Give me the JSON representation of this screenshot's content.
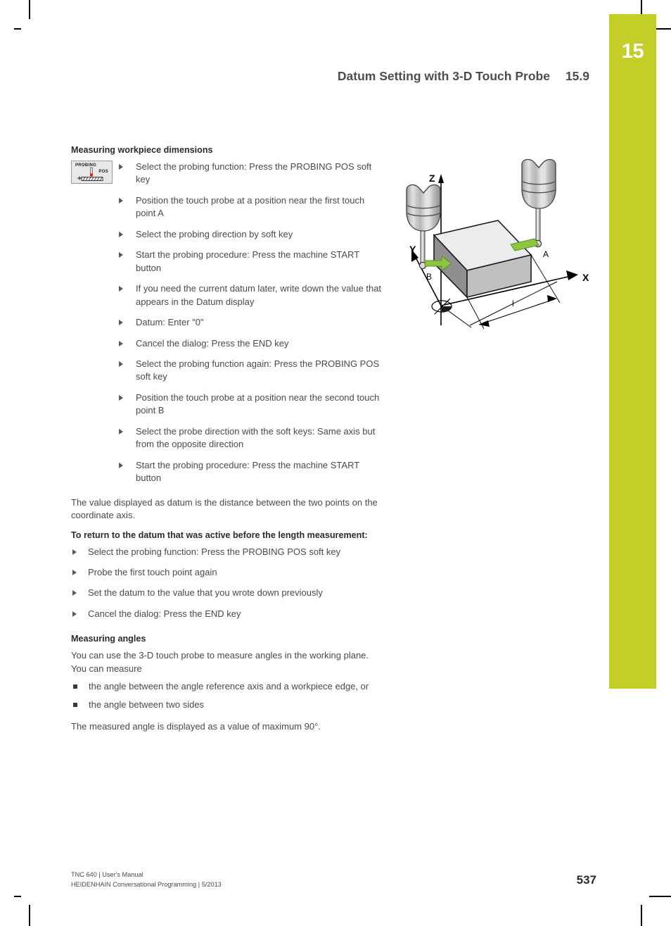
{
  "chapter": {
    "number": "15",
    "accent_color": "#c3ce26"
  },
  "running_head": {
    "title": "Datum Setting with 3-D Touch Probe",
    "section_number": "15.9"
  },
  "content": {
    "heading_dimensions": "Measuring workpiece dimensions",
    "softkey": {
      "label_top": "PROBING",
      "label_bottom": "POS",
      "icon": "probe-touch-surface-icon"
    },
    "steps": [
      "Select the probing function: Press the PROBING POS soft key",
      "Position the touch probe at a position near the first touch point A",
      "Select the probing direction by soft key",
      "Start the probing procedure: Press the machine START button",
      "If you need the current datum later, write down the value that appears in the Datum display",
      "Datum: Enter \"0\"",
      "Cancel the dialog: Press the END key",
      "Select the probing function again: Press the PROBING POS soft key",
      "Position the touch probe at a position near the second touch point B",
      "Select the probe direction with the soft keys: Same axis but from the opposite direction",
      "Start the probing procedure: Press the machine START button"
    ],
    "paragraph_datum_distance": "The value displayed as datum is the distance between the two points on the coordinate axis.",
    "heading_return": "To return to the datum that was active before the length measurement:",
    "return_steps": [
      "Select the probing function: Press the PROBING POS soft key",
      "Probe the first touch point again",
      "Set the datum to the value that you wrote down previously",
      "Cancel the dialog: Press the END key"
    ],
    "heading_angles": "Measuring angles",
    "paragraph_angles_intro": "You can use the 3-D touch probe to measure angles in the working plane. You can measure",
    "angle_items": [
      "the angle between the angle reference axis and a workpiece edge, or",
      "the angle between two sides"
    ],
    "paragraph_angles_max": "The measured angle is displayed as a value of maximum 90°."
  },
  "figure": {
    "name": "3d-touch-probe-workpiece-length-measurement-diagram",
    "axis_labels": {
      "z": "Z",
      "y": "Y",
      "x": "X"
    },
    "touch_point_a": "A",
    "touch_point_b": "B",
    "dimension_label": "l",
    "arrow_color": "#8cc63e",
    "workpiece_top_color": "#e9e9e9",
    "workpiece_front_color": "#c0c0c0",
    "workpiece_side_color": "#8f8f8f"
  },
  "footer": {
    "line1": "TNC 640 | User's Manual",
    "line2": "HEIDENHAIN Conversational Programming | 5/2013",
    "page_number": "537"
  }
}
